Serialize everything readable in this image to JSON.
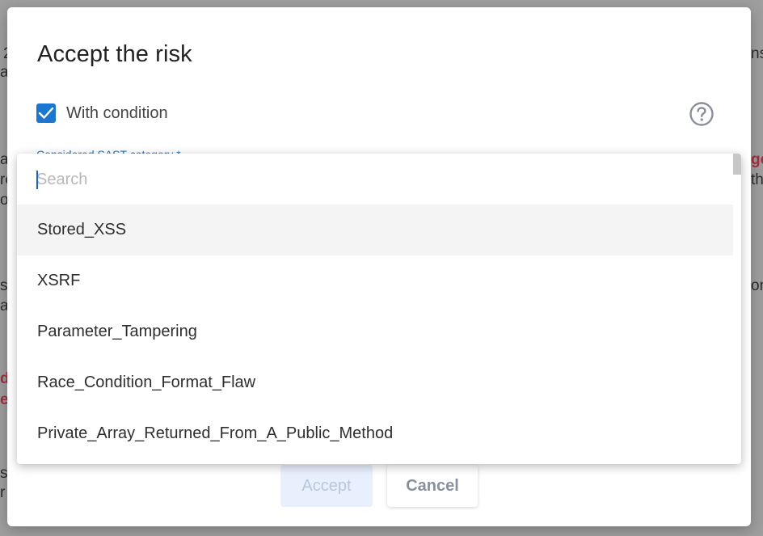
{
  "background": {
    "fragments": [
      "2",
      "als",
      "al",
      "ro",
      "ol",
      "s",
      "ar",
      "de",
      "e",
      "s",
      "r",
      "ns",
      "ge",
      "th",
      "on"
    ]
  },
  "dialog": {
    "title": "Accept the risk",
    "with_condition": {
      "label": "With condition",
      "checked": true
    },
    "category_field_label": "Considered SAST category *",
    "accept_label": "Accept",
    "cancel_label": "Cancel"
  },
  "dropdown": {
    "search_placeholder": "Search",
    "search_value": "",
    "options": [
      "Stored_XSS",
      "XSRF",
      "Parameter_Tampering",
      "Race_Condition_Format_Flaw",
      "Private_Array_Returned_From_A_Public_Method"
    ]
  },
  "colors": {
    "accent": "#1976d2",
    "overlay": "#9e9e9e",
    "danger_text": "#a3303e"
  }
}
